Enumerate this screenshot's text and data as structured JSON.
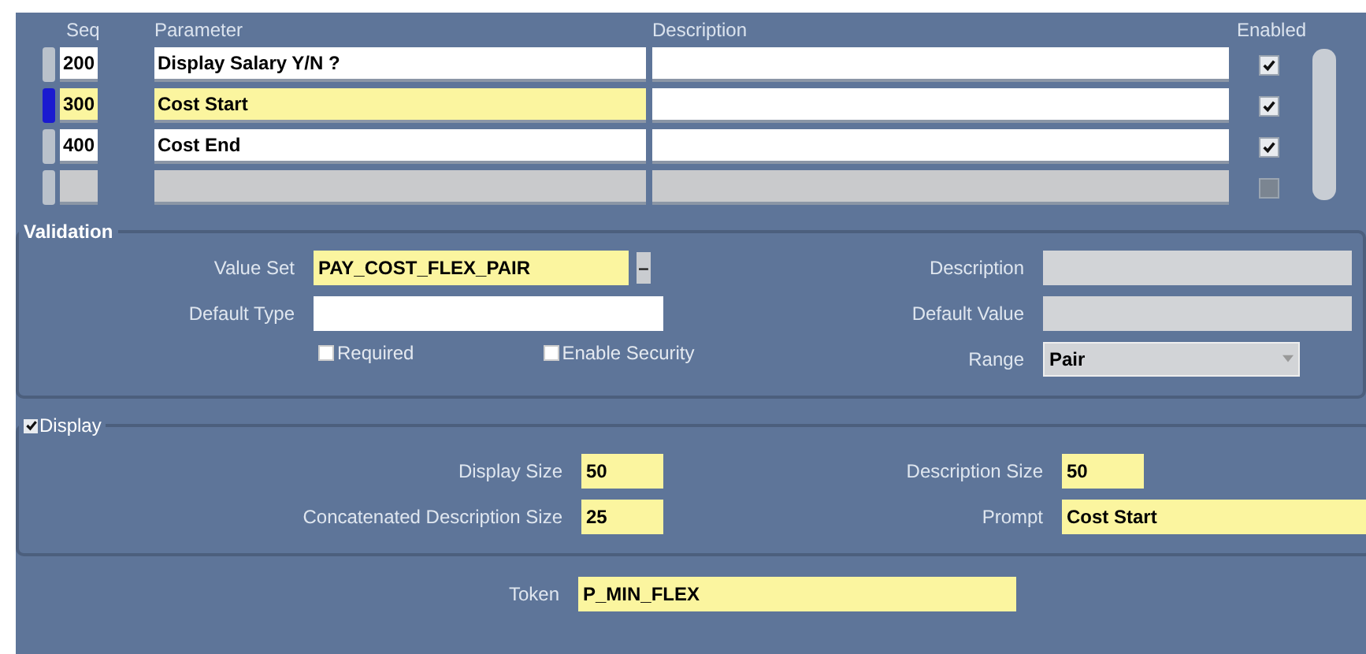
{
  "table": {
    "columns": [
      {
        "label": "Seq"
      },
      {
        "label": "Parameter"
      },
      {
        "label": "Description"
      },
      {
        "label": "Enabled"
      }
    ],
    "rows": [
      {
        "seq": "200",
        "parameter": "Display Salary Y/N ?",
        "enabled": true,
        "selected": false,
        "disabled": false
      },
      {
        "seq": "300",
        "parameter": "Cost Start",
        "enabled": true,
        "selected": true,
        "disabled": false
      },
      {
        "seq": "400",
        "parameter": "Cost End",
        "enabled": true,
        "selected": false,
        "disabled": false
      },
      {
        "enabled": false,
        "selected": false,
        "disabled": true
      }
    ]
  },
  "validation": {
    "title": "Validation",
    "value_set": {
      "label": "Value Set",
      "value": "PAY_COST_FLEX_PAIR",
      "lov_button": "–"
    },
    "default_type": {
      "label": "Default Type"
    },
    "checkboxes": [
      {
        "label": "Required",
        "checked": false
      },
      {
        "label": "Enable Security",
        "checked": false
      }
    ],
    "description": {
      "label": "Description"
    },
    "default_value": {
      "label": "Default Value"
    },
    "range": {
      "label": "Range",
      "value": "Pair"
    }
  },
  "display": {
    "label": "Display",
    "checked": true,
    "display_size": {
      "label": "Display Size",
      "value": "50"
    },
    "concatenated_description_size": {
      "label": "Concatenated Description Size",
      "value": "25"
    },
    "description_size": {
      "label": "Description Size",
      "value": "50"
    },
    "prompt": {
      "label": "Prompt",
      "value": "Cost Start"
    }
  },
  "token": {
    "label": "Token",
    "value": "P_MIN_FLEX"
  }
}
